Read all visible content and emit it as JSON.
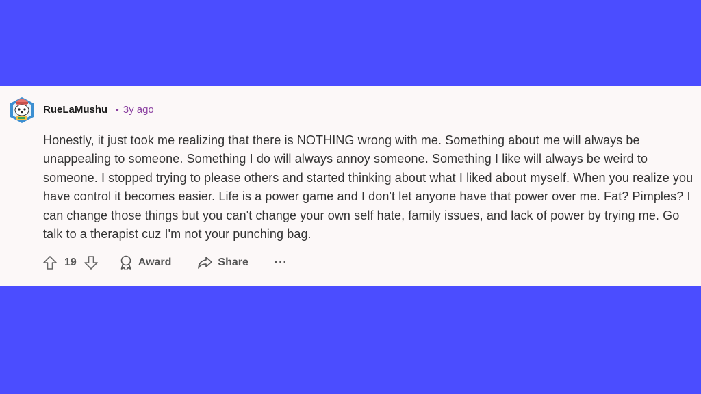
{
  "comment": {
    "author": "RueLaMushu",
    "separator": "•",
    "age": "3y ago",
    "text": "Honestly, it just took me realizing that there is NOTHING wrong with me. Something about me will always be unappealing to someone. Something I do will always annoy someone. Something I like will always be weird to someone. I stopped trying to please others and started thinking about what I liked about myself. When you realize you have control it becomes easier. Life is a power game and I don't let anyone have that power over me. Fat? Pimples? I can change those things but you can't change your own self hate, family issues, and lack of power by trying me. Go talk to a therapist cuz I'm not your punching bag.",
    "votes": "19",
    "award_label": "Award",
    "share_label": "Share",
    "more_label": "···"
  },
  "colors": {
    "background": "#4b4dff",
    "card": "#fcf8f8",
    "timestamp": "#8a3fa0"
  }
}
